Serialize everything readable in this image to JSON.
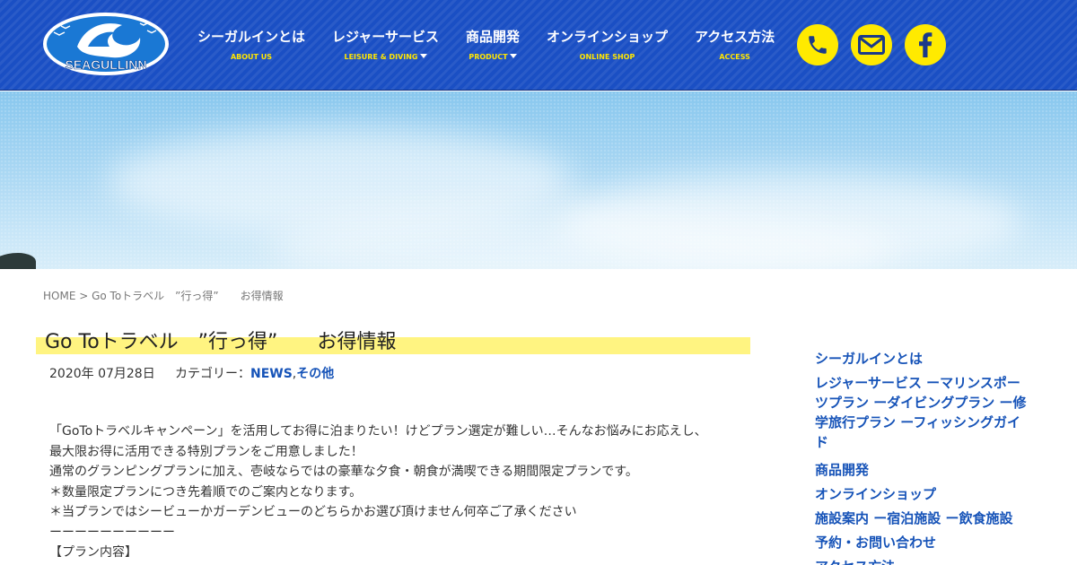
{
  "header": {
    "logo_text": "SEAGULLINN",
    "nav": [
      {
        "label": "シーガルインとは",
        "sub": "ABOUT US",
        "dropdown": false
      },
      {
        "label": "レジャーサービス",
        "sub": "LEISURE & DIVING",
        "dropdown": true
      },
      {
        "label": "商品開発",
        "sub": "PRODUCT",
        "dropdown": true
      },
      {
        "label": "オンラインショップ",
        "sub": "ONLINE SHOP",
        "dropdown": false
      },
      {
        "label": "アクセス方法",
        "sub": "ACCESS",
        "dropdown": false
      }
    ],
    "icons": [
      "phone-icon",
      "mail-icon",
      "facebook-icon"
    ]
  },
  "breadcrumb": {
    "home": "HOME",
    "separator": " > ",
    "current": "Go Toトラベル　”行っ得”　　お得情報"
  },
  "post": {
    "title": "Go Toトラベル　”行っ得”　　お得情報",
    "date": "2020年 07月28日",
    "category_prefix": "カテゴリー：",
    "category_1": "NEWS",
    "category_sep": ",",
    "category_2": "その他",
    "paragraphs": [
      "「GoToトラベルキャンペーン」を活用してお得に泊まりたい！けどプラン選定が難しい…そんなお悩みにお応えし、最大限お得に活用できる特別プランをご用意しました！",
      "通常のグランピングプランに加え、壱岐ならではの豪華な夕食・朝食が満喫できる期間限定プランです。",
      "＊数量限定プランにつき先着順でのご案内となります。",
      "＊当プランではシービューかガーデンビューのどちらかお選び頂けません何卒ご了承ください",
      "ーーーーーーーーーー",
      "【プラン内容】"
    ]
  },
  "sidebar": {
    "items": [
      "シーガルインとは",
      "レジャーサービス ーマリンスポーツプラン ーダイビングプラン ー修学旅行プラン ーフィッシングガイド",
      "商品開発",
      "オンラインショップ",
      "施設案内 ー宿泊施設 ー飲食施設",
      "予約・お問い合わせ",
      "アクセス方法"
    ]
  },
  "colors": {
    "header_blue": "#1a4fc4",
    "accent_yellow": "#ffea00",
    "title_highlight": "#fff481",
    "link_blue": "#1653b8"
  }
}
